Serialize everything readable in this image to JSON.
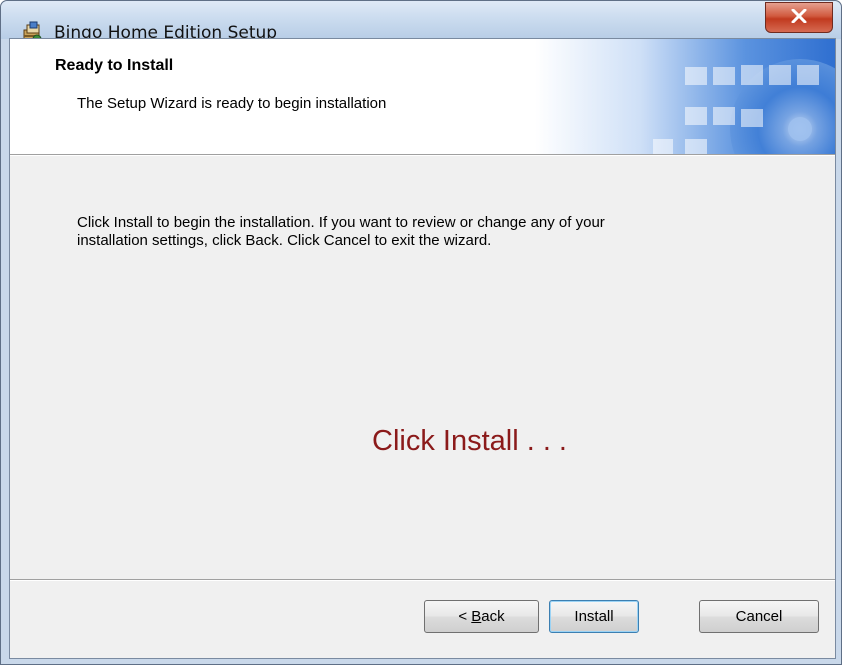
{
  "window": {
    "title": "Bingo Home Edition Setup",
    "close_icon": "close-x-icon",
    "app_icon": "installer-package-icon"
  },
  "banner": {
    "title": "Ready to Install",
    "subtitle": "The Setup Wizard is ready to begin installation"
  },
  "main": {
    "instruction_lines": [
      "Click Install to begin the installation.  If you want to review or change any of your",
      "installation settings, click Back.  Click Cancel to exit the wizard."
    ],
    "hint": "Click Install . . .",
    "hint_color": "#8b1a1a"
  },
  "buttons": {
    "back_prefix": "< ",
    "back_mnemonic": "B",
    "back_rest": "ack",
    "install": "Install",
    "cancel": "Cancel"
  },
  "colors": {
    "banner_accent": "#3a7bd5",
    "close_button": "#c13a1f",
    "default_button_border": "#3c7fb1"
  }
}
